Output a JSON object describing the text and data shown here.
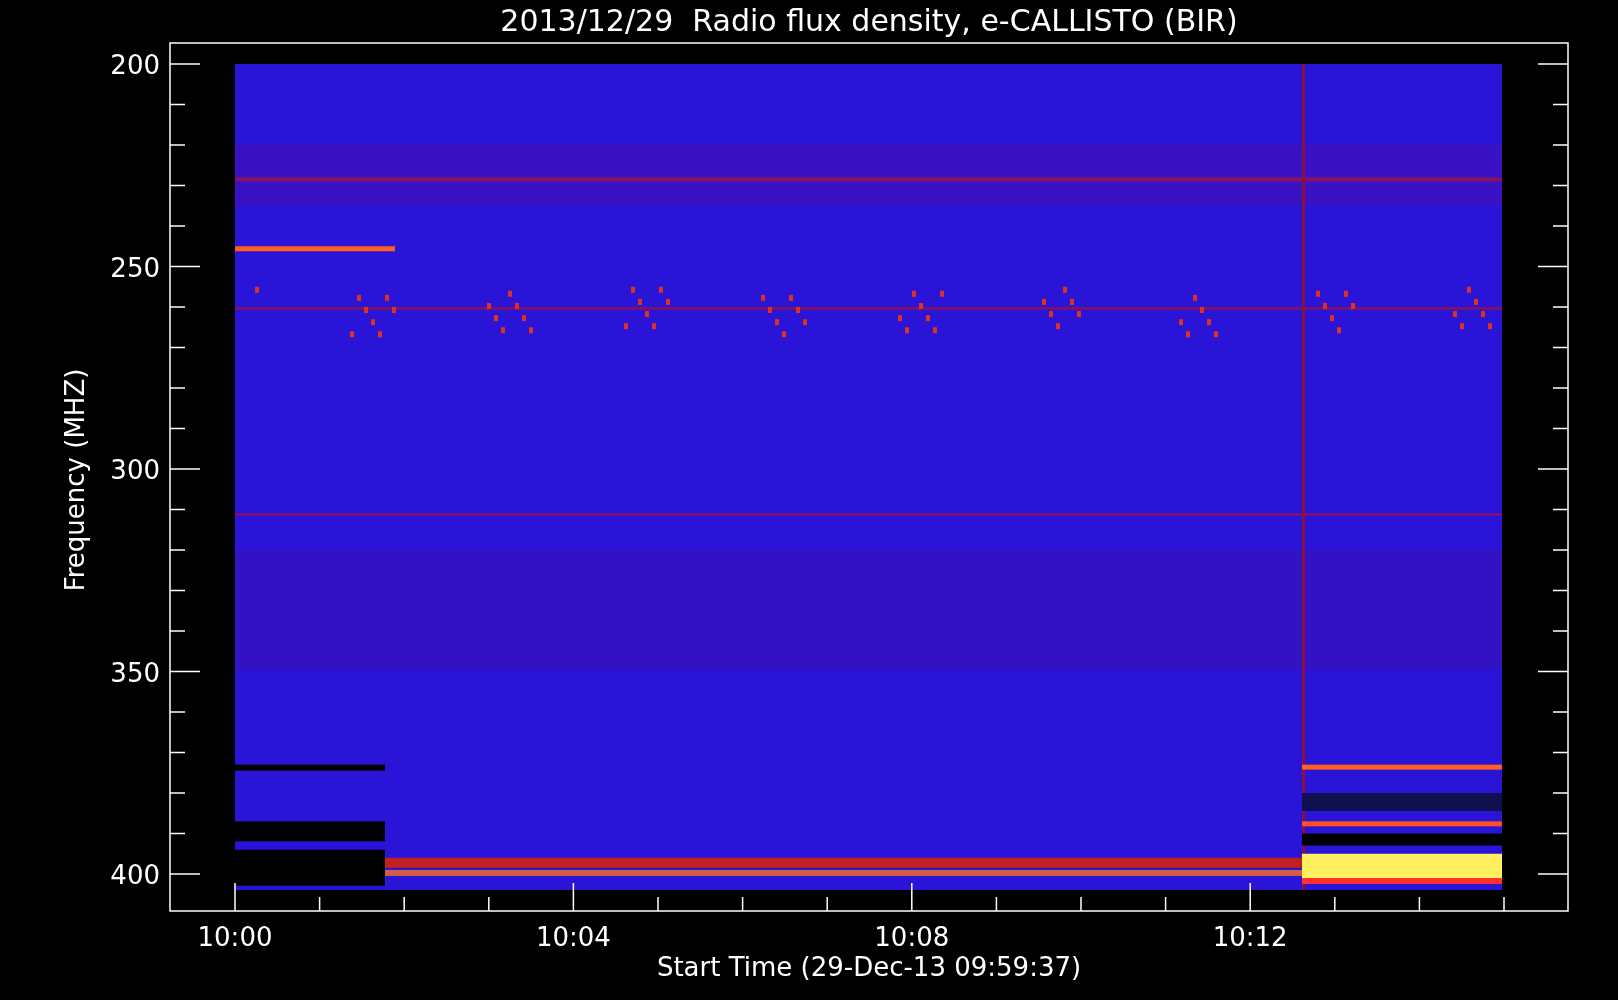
{
  "title": "2013/12/29  Radio flux density, e-CALLISTO (BIR)",
  "y_axis": {
    "label": "Frequency (MHZ)",
    "ticks": [
      "200",
      "250",
      "300",
      "350",
      "400"
    ]
  },
  "x_axis": {
    "label": "Start Time (29-Dec-13 09:59:37)",
    "ticks": [
      "10:00",
      "10:04",
      "10:08",
      "10:12"
    ]
  }
}
